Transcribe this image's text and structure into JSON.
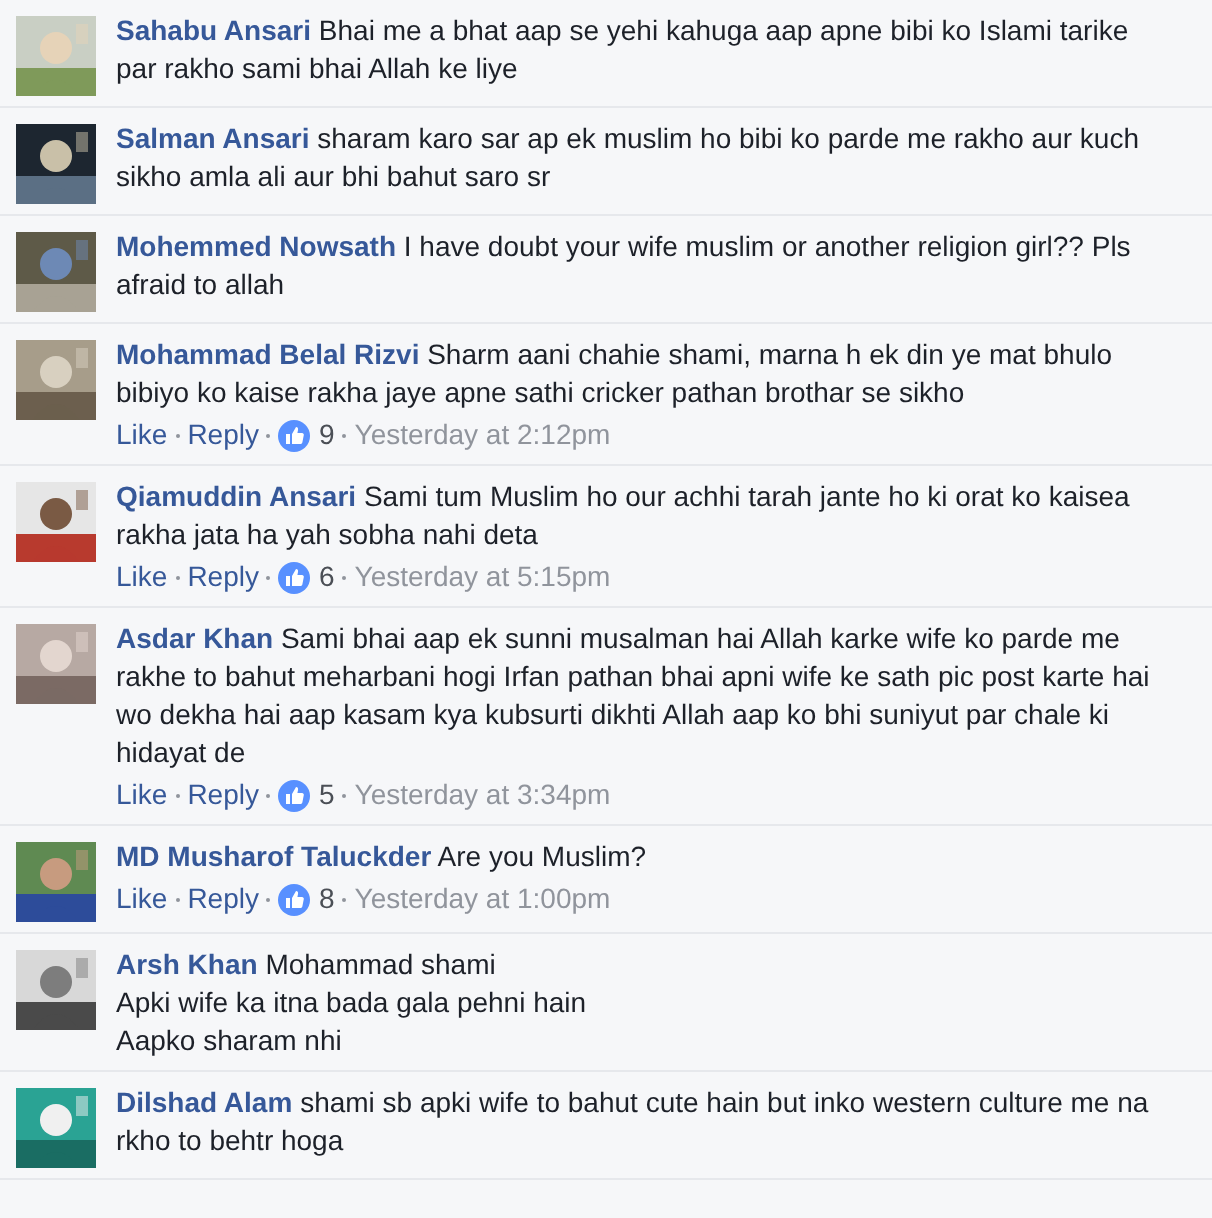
{
  "comments": [
    {
      "author": "Sahabu Ansari",
      "text": "Bhai me a bhat aap se yehi kahuga aap apne bibi ko Islami tarike par rakho sami bhai Allah ke liye"
    },
    {
      "author": "Salman Ansari",
      "text": "sharam karo sar ap ek muslim ho bibi ko parde me rakho aur kuch sikho amla ali aur bhi bahut saro sr"
    },
    {
      "author": "Mohemmed Nowsath",
      "text": "I have doubt your wife muslim or another religion girl?? Pls afraid to allah"
    },
    {
      "author": "Mohammad Belal Rizvi",
      "text": "Sharm aani chahie shami, marna h ek din ye mat bhulo bibiyo ko kaise rakha jaye apne sathi cricker pathan brothar se sikho",
      "actions": {
        "like": "Like",
        "reply": "Reply",
        "likes": "9",
        "time": "Yesterday at 2:12pm"
      }
    },
    {
      "author": "Qiamuddin Ansari",
      "text": "Sami tum Muslim ho our achhi tarah jante ho ki orat ko kaisea rakha jata ha yah sobha nahi deta",
      "actions": {
        "like": "Like",
        "reply": "Reply",
        "likes": "6",
        "time": "Yesterday at 5:15pm"
      }
    },
    {
      "author": "Asdar Khan",
      "text": "Sami bhai aap ek sunni musalman hai Allah karke wife ko parde me rakhe to bahut meharbani hogi Irfan pathan bhai apni wife ke sath pic post karte hai wo dekha hai aap kasam kya kubsurti dikhti Allah aap ko bhi suniyut par chale ki hidayat de",
      "actions": {
        "like": "Like",
        "reply": "Reply",
        "likes": "5",
        "time": "Yesterday at 3:34pm"
      }
    },
    {
      "author": "MD Musharof Taluckder",
      "text": "Are you Muslim?",
      "actions": {
        "like": "Like",
        "reply": "Reply",
        "likes": "8",
        "time": "Yesterday at 1:00pm"
      }
    },
    {
      "author": "Arsh Khan",
      "text": "Mohammad shami\nApki wife ka itna bada gala pehni hain\nAapko sharam nhi"
    },
    {
      "author": "Dilshad Alam",
      "text": "shami sb apki wife to bahut cute hain but inko western culture me na rkho to behtr hoga"
    }
  ]
}
